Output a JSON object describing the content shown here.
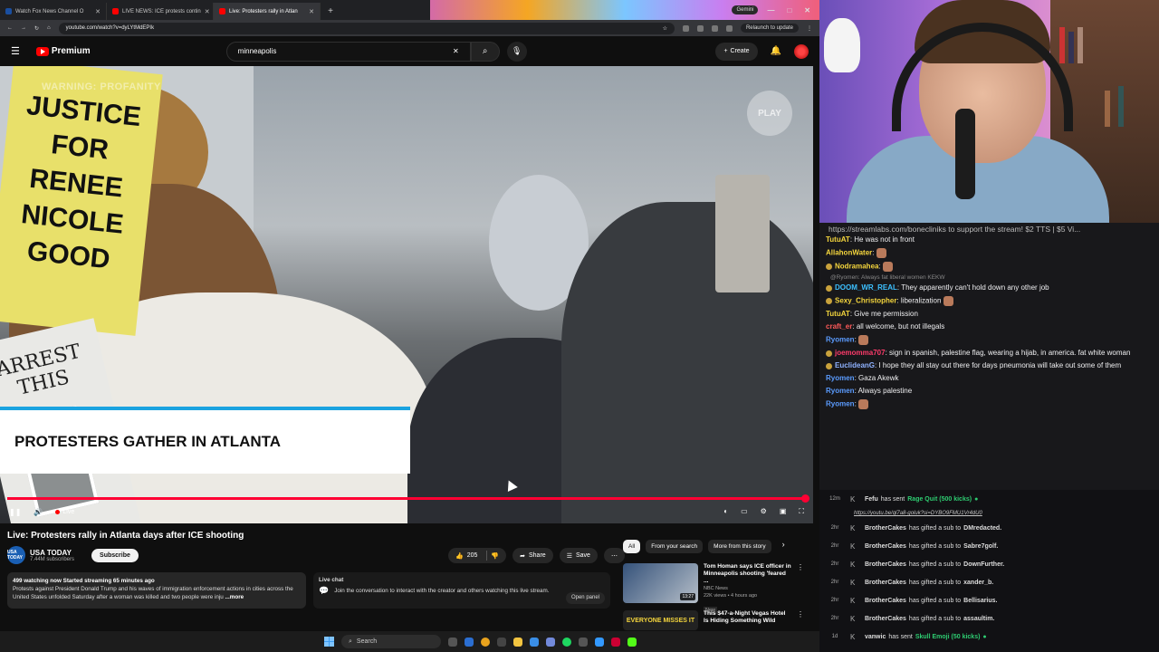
{
  "browser": {
    "tabs": [
      {
        "label": "Watch Fox News Channel O",
        "type": "fox"
      },
      {
        "label": "LIVE NEWS: ICE protests contin",
        "type": "yt"
      },
      {
        "label": "Live: Protesters rally in Atlan",
        "type": "yt"
      }
    ],
    "new_tab": "+",
    "profile_label": "Gemini",
    "url": "youtube.com/watch?v=dyLYtMdEPIk",
    "relaunch": "Relaunch to update"
  },
  "youtube": {
    "brand": "Premium",
    "search_value": "minneapolis",
    "create_label": "Create",
    "video": {
      "warning": "WARNING: PROFANITY",
      "bug": "PLAY",
      "sign_justice": "JUSTICE FOR RENEE NICOLE GOOD",
      "sign_arrest": "ARREST THIS",
      "lower_third": "PROTESTERS GATHER IN ATLANTA",
      "live_label": "Live"
    },
    "title": "Live: Protesters rally in Atlanta days after ICE shooting",
    "channel": {
      "name": "USA TODAY",
      "logo": "USA TODAY",
      "subs": "7.44M subscribers",
      "subscribe": "Subscribe"
    },
    "actions": {
      "likes": "205",
      "share": "Share",
      "save": "Save"
    },
    "description": {
      "stats": "499 watching now  Started streaming 65 minutes ago",
      "text": "Protests against President Donald Trump and his waves of immigration enforcement actions in cities across the United States unfolded Saturday after a woman was killed and two people were inju",
      "more": "...more"
    },
    "live_chat": {
      "title": "Live chat",
      "text": "Join the conversation to interact with the creator and others watching this live stream.",
      "open": "Open panel"
    },
    "chips": [
      "All",
      "From your search",
      "More from this story"
    ],
    "recommendations": [
      {
        "title": "Tom Homan says ICE officer in Minneapolis shooting 'feared ...",
        "channel": "NBC News",
        "meta": "22K views • 4 hours ago",
        "badge": "New",
        "duration": "13:27"
      },
      {
        "title": "This $47-a-Night Vegas Hotel Is Hiding Something Wild",
        "channel": "",
        "meta": "",
        "badge": "",
        "duration": "",
        "thumb_text": "EVERYONE MISSES IT"
      }
    ]
  },
  "taskbar": {
    "search": "Search"
  },
  "stream_chat": {
    "top_link": "https://streamlabs.com/bonecliniks",
    "top_text": " to support the stream! $2 TTS | $5 Vi...",
    "messages": [
      {
        "user": "TutuAT",
        "color": "#f5d63d",
        "text": "He was not in front",
        "badge": false,
        "emote": false
      },
      {
        "user": "AllahonWater",
        "color": "#f5d63d",
        "text": "",
        "badge": false,
        "emote": true
      },
      {
        "user": "Nodramahea",
        "color": "#f5d63d",
        "text": "",
        "badge": true,
        "emote": true
      },
      {
        "reply": "@Ryomen: Always fat liberal women KEKW"
      },
      {
        "user": "DOOM_WR_REAL",
        "color": "#3cc0ff",
        "text": "They apparently can't hold down any other job",
        "badge": true,
        "emote": false
      },
      {
        "user": "Sexy_Christopher",
        "color": "#f5d63d",
        "text": "liberalization",
        "badge": true,
        "emote": true
      },
      {
        "user": "TutuAT",
        "color": "#f5d63d",
        "text": "Give me permission",
        "badge": false,
        "emote": false
      },
      {
        "user": "craft_er",
        "color": "#ff5a5a",
        "text": "all welcome, but not illegals",
        "badge": false,
        "emote": false
      },
      {
        "user": "Ryomen",
        "color": "#5b9cff",
        "text": "",
        "badge": false,
        "emote": true
      },
      {
        "user": "joemomma707",
        "color": "#ff3b6b",
        "text": "sign in spanish, palestine flag, wearing a hijab, in america. fat white woman",
        "badge": true,
        "emote": false
      },
      {
        "user": "EuclideanG",
        "color": "#8fb2ff",
        "text": "I hope they all stay out there for days pneumonia will take out some of them",
        "badge": true,
        "emote": false
      },
      {
        "user": "Ryomen",
        "color": "#5b9cff",
        "text": "Gaza Akewk",
        "badge": false,
        "emote": false
      },
      {
        "user": "Ryomen",
        "color": "#5b9cff",
        "text": "Always palestine",
        "badge": false,
        "emote": false
      },
      {
        "user": "Ryomen",
        "color": "#5b9cff",
        "text": "",
        "badge": false,
        "emote": true
      }
    ],
    "events": [
      {
        "time": "12m",
        "user": "Fefu",
        "text": "has sent",
        "item": "Rage Quit (500 kicks)",
        "link": "https://youtu.be/ql7a8-goluk?si=DYBO9FMU1Vr4dU0"
      },
      {
        "time": "2hr",
        "user": "BrotherCakes",
        "text": "has gifted a sub to",
        "target": "DMredacted."
      },
      {
        "time": "2hr",
        "user": "BrotherCakes",
        "text": "has gifted a sub to",
        "target": "Sabre7golf."
      },
      {
        "time": "2hr",
        "user": "BrotherCakes",
        "text": "has gifted a sub to",
        "target": "DownFurther."
      },
      {
        "time": "2hr",
        "user": "BrotherCakes",
        "text": "has gifted a sub to",
        "target": "xander_b."
      },
      {
        "time": "2hr",
        "user": "BrotherCakes",
        "text": "has gifted a sub to",
        "target": "Bellisarius."
      },
      {
        "time": "2hr",
        "user": "BrotherCakes",
        "text": "has gifted a sub to",
        "target": "assaultim."
      },
      {
        "time": "1d",
        "user": "vanwic",
        "text": "has sent",
        "item": "Skull Emoji (50 kicks)"
      }
    ]
  }
}
